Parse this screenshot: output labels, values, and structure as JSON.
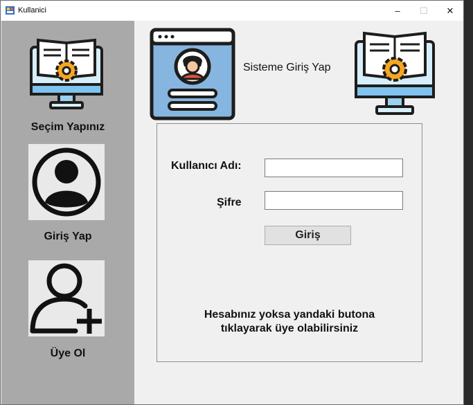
{
  "window": {
    "title": "Kullanici",
    "controls": {
      "minimize": "–",
      "maximize": "☐",
      "close": "✕"
    }
  },
  "sidebar": {
    "items": [
      {
        "label": "Seçim Yapınız",
        "icon": "computer-settings-icon"
      },
      {
        "label": "Giriş Yap",
        "icon": "user-circle-icon"
      },
      {
        "label": "Üye Ol",
        "icon": "add-user-icon"
      }
    ]
  },
  "header": {
    "title": "Sisteme Giriş Yap",
    "left_icon": "profile-browser-icon",
    "right_icon": "computer-settings-icon"
  },
  "login": {
    "username_label": "Kullanıcı Adı:",
    "username_value": "",
    "password_label": "Şifre",
    "password_value": "",
    "login_button": "Giriş",
    "info_line1": "Hesabınız yoksa yandaki butona",
    "info_line2": "tıklayarak üye olabilirsiniz"
  },
  "colors": {
    "sidebar_bg": "#a9a9a9",
    "form_bg": "#f0f0f0",
    "icon_blue": "#86b5e0",
    "icon_dark": "#1d1d1b",
    "gear_orange": "#f5a623"
  }
}
